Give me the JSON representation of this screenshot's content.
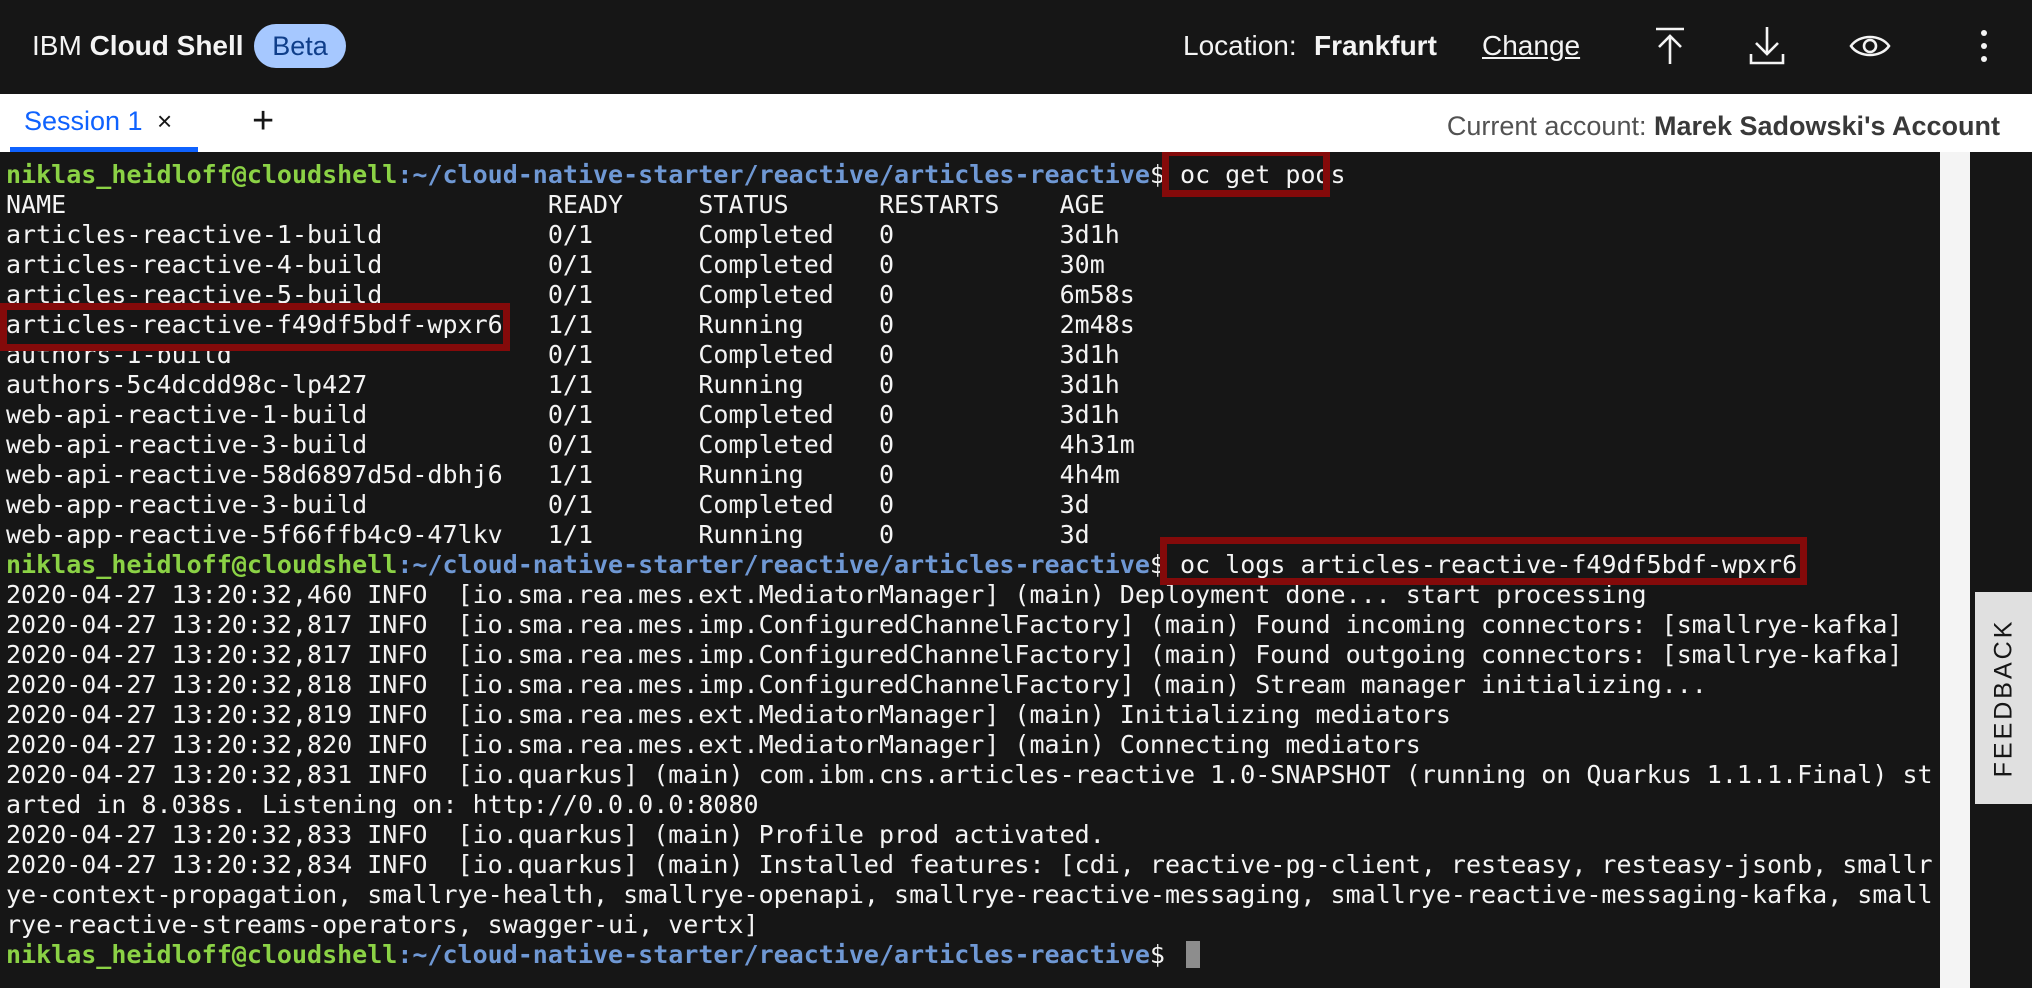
{
  "header": {
    "brand_prefix": "IBM",
    "brand_name": "Cloud Shell",
    "badge": "Beta",
    "location_label": "Location:",
    "location_value": "Frankfurt",
    "change_label": "Change",
    "icons": [
      "upload-icon",
      "download-icon",
      "eye-icon",
      "overflow-menu-icon"
    ]
  },
  "tabs": {
    "items": [
      {
        "label": "Session 1",
        "active": true
      }
    ],
    "close_glyph": "×",
    "add_glyph": "+",
    "account_label": "Current account: ",
    "account_name": "Marek Sadowski's Account"
  },
  "terminal": {
    "user": "niklas_heidloff@cloudshell",
    "path": ":~/cloud-native-starter/reactive/articles-reactive",
    "dollar": "$ ",
    "lines": [
      {
        "type": "prompt",
        "cmd": "oc get pods"
      },
      {
        "type": "text",
        "text": "NAME                                READY     STATUS      RESTARTS    AGE"
      },
      {
        "type": "text",
        "text": "articles-reactive-1-build           0/1       Completed   0           3d1h"
      },
      {
        "type": "text",
        "text": "articles-reactive-4-build           0/1       Completed   0           30m"
      },
      {
        "type": "text",
        "text": "articles-reactive-5-build           0/1       Completed   0           6m58s"
      },
      {
        "type": "text",
        "text": "articles-reactive-f49df5bdf-wpxr6   1/1       Running     0           2m48s"
      },
      {
        "type": "text",
        "text": "authors-1-build                     0/1       Completed   0           3d1h"
      },
      {
        "type": "text",
        "text": "authors-5c4dcdd98c-lp427            1/1       Running     0           3d1h"
      },
      {
        "type": "text",
        "text": "web-api-reactive-1-build            0/1       Completed   0           3d1h"
      },
      {
        "type": "text",
        "text": "web-api-reactive-3-build            0/1       Completed   0           4h31m"
      },
      {
        "type": "text",
        "text": "web-api-reactive-58d6897d5d-dbhj6   1/1       Running     0           4h4m"
      },
      {
        "type": "text",
        "text": "web-app-reactive-3-build            0/1       Completed   0           3d"
      },
      {
        "type": "text",
        "text": "web-app-reactive-5f66ffb4c9-47lkv   1/1       Running     0           3d"
      },
      {
        "type": "prompt",
        "cmd": "oc logs articles-reactive-f49df5bdf-wpxr6"
      },
      {
        "type": "text",
        "text": "2020-04-27 13:20:32,460 INFO  [io.sma.rea.mes.ext.MediatorManager] (main) Deployment done... start processing"
      },
      {
        "type": "text",
        "text": "2020-04-27 13:20:32,817 INFO  [io.sma.rea.mes.imp.ConfiguredChannelFactory] (main) Found incoming connectors: [smallrye-kafka]"
      },
      {
        "type": "text",
        "text": "2020-04-27 13:20:32,817 INFO  [io.sma.rea.mes.imp.ConfiguredChannelFactory] (main) Found outgoing connectors: [smallrye-kafka]"
      },
      {
        "type": "text",
        "text": "2020-04-27 13:20:32,818 INFO  [io.sma.rea.mes.imp.ConfiguredChannelFactory] (main) Stream manager initializing..."
      },
      {
        "type": "text",
        "text": "2020-04-27 13:20:32,819 INFO  [io.sma.rea.mes.ext.MediatorManager] (main) Initializing mediators"
      },
      {
        "type": "text",
        "text": "2020-04-27 13:20:32,820 INFO  [io.sma.rea.mes.ext.MediatorManager] (main) Connecting mediators"
      },
      {
        "type": "text",
        "text": "2020-04-27 13:20:32,831 INFO  [io.quarkus] (main) com.ibm.cns.articles-reactive 1.0-SNAPSHOT (running on Quarkus 1.1.1.Final) st"
      },
      {
        "type": "text",
        "text": "arted in 8.038s. Listening on: http://0.0.0.0:8080"
      },
      {
        "type": "text",
        "text": "2020-04-27 13:20:32,833 INFO  [io.quarkus] (main) Profile prod activated."
      },
      {
        "type": "text",
        "text": "2020-04-27 13:20:32,834 INFO  [io.quarkus] (main) Installed features: [cdi, reactive-pg-client, resteasy, resteasy-jsonb, smallr"
      },
      {
        "type": "text",
        "text": "ye-context-propagation, smallrye-health, smallrye-openapi, smallrye-reactive-messaging, smallrye-reactive-messaging-kafka, small"
      },
      {
        "type": "text",
        "text": "rye-reactive-streams-operators, swagger-ui, vertx]"
      },
      {
        "type": "prompt",
        "cmd": ""
      }
    ]
  },
  "feedback_label": "FEEDBACK",
  "colors": {
    "background": "#161616",
    "prompt_user": "#8bd245",
    "prompt_path": "#6f98d4",
    "highlight": "#840a0a",
    "tab_accent": "#0f62fe",
    "badge_bg": "#a6c8ff"
  }
}
